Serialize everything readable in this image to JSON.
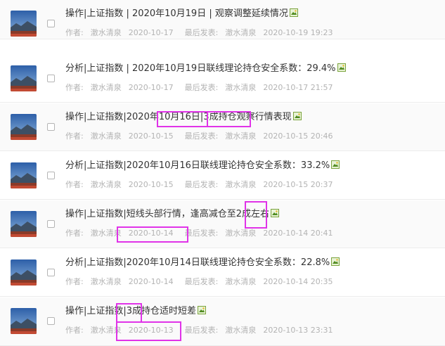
{
  "threads": [
    {
      "title": "操作|上证指数 | 2020年10月19日 | 观察调整延续情况",
      "author_label": "作者:",
      "author": "澈水清泉",
      "date": "2020-10-17",
      "last_label": "最后发表:",
      "last_author": "澈水清泉",
      "last_time": "2020-10-19 19:23"
    },
    {
      "title": "分析|上证指数 | 2020年10月19日联线理论持仓安全系数：29.4%",
      "author_label": "作者:",
      "author": "澈水清泉",
      "date": "2020-10-17",
      "last_label": "最后发表:",
      "last_author": "澈水清泉",
      "last_time": "2020-10-17 21:57"
    },
    {
      "title": "操作|上证指数|2020年10月16日|3成持仓观察行情表现",
      "author_label": "作者:",
      "author": "澈水清泉",
      "date": "2020-10-15",
      "last_label": "最后发表:",
      "last_author": "澈水清泉",
      "last_time": "2020-10-15 20:46"
    },
    {
      "title": "分析|上证指数|2020年10月16日联线理论持仓安全系数：33.2%",
      "author_label": "作者:",
      "author": "澈水清泉",
      "date": "2020-10-15",
      "last_label": "最后发表:",
      "last_author": "澈水清泉",
      "last_time": "2020-10-15 20:37"
    },
    {
      "title": "操作|上证指数|短线头部行情，逢高减仓至2成左右",
      "author_label": "作者:",
      "author": "澈水清泉",
      "date": "2020-10-14",
      "last_label": "最后发表:",
      "last_author": "澈水清泉",
      "last_time": "2020-10-14 20:41"
    },
    {
      "title": "分析|上证指数|2020年10月14日联线理论持仓安全系数：22.8%",
      "author_label": "作者:",
      "author": "澈水清泉",
      "date": "2020-10-14",
      "last_label": "最后发表:",
      "last_author": "澈水清泉",
      "last_time": "2020-10-14 20:35"
    },
    {
      "title": "操作|上证指数|3成持仓适时短差",
      "author_label": "作者:",
      "author": "澈水清泉",
      "date": "2020-10-13",
      "last_label": "最后发表:",
      "last_author": "澈水清泉",
      "last_time": "2020-10-13 23:31"
    }
  ],
  "icons": {
    "thumbnail": "landscape-thumbnail-icon",
    "attachment": "image-attachment-icon"
  },
  "colors": {
    "highlight": "#e033e8",
    "title_text": "#333333",
    "meta_text": "#b3b3b3"
  }
}
